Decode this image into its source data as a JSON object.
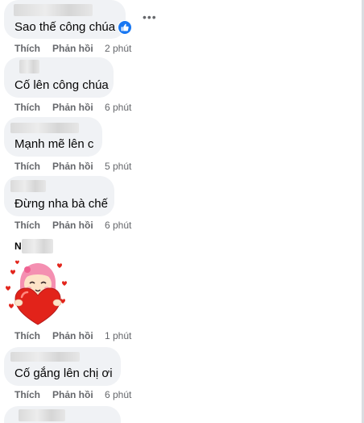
{
  "comments": [
    {
      "text": "Sao thế công chúa",
      "like_label": "Thích",
      "reply_label": "Phản hồi",
      "time": "2 phút"
    },
    {
      "text": "Cố lên công chúa",
      "like_label": "Thích",
      "reply_label": "Phản hồi",
      "time": "6 phút"
    },
    {
      "text": "Mạnh mẽ lên c",
      "like_label": "Thích",
      "reply_label": "Phản hồi",
      "time": "5 phút"
    },
    {
      "text": "Đừng nha bà chế",
      "like_label": "Thích",
      "reply_label": "Phản hồi",
      "time": "6 phút"
    },
    {
      "author_initial": "N",
      "like_label": "Thích",
      "reply_label": "Phản hồi",
      "time": "1 phút"
    },
    {
      "text": "Cố gắng lên chị ơi",
      "like_label": "Thích",
      "reply_label": "Phản hồi",
      "time": "6 phút"
    }
  ],
  "icons": {
    "like_reaction": "thumbs-up-icon",
    "more_options": "more-horizontal-icon",
    "sticker": "heart-girl-sticker"
  },
  "colors": {
    "bubble": "#f0f2f5",
    "secondary_text": "#65676b",
    "like_blue": "#1877f2",
    "heart_red": "#e2231a",
    "hair_pink": "#f48fb1"
  }
}
